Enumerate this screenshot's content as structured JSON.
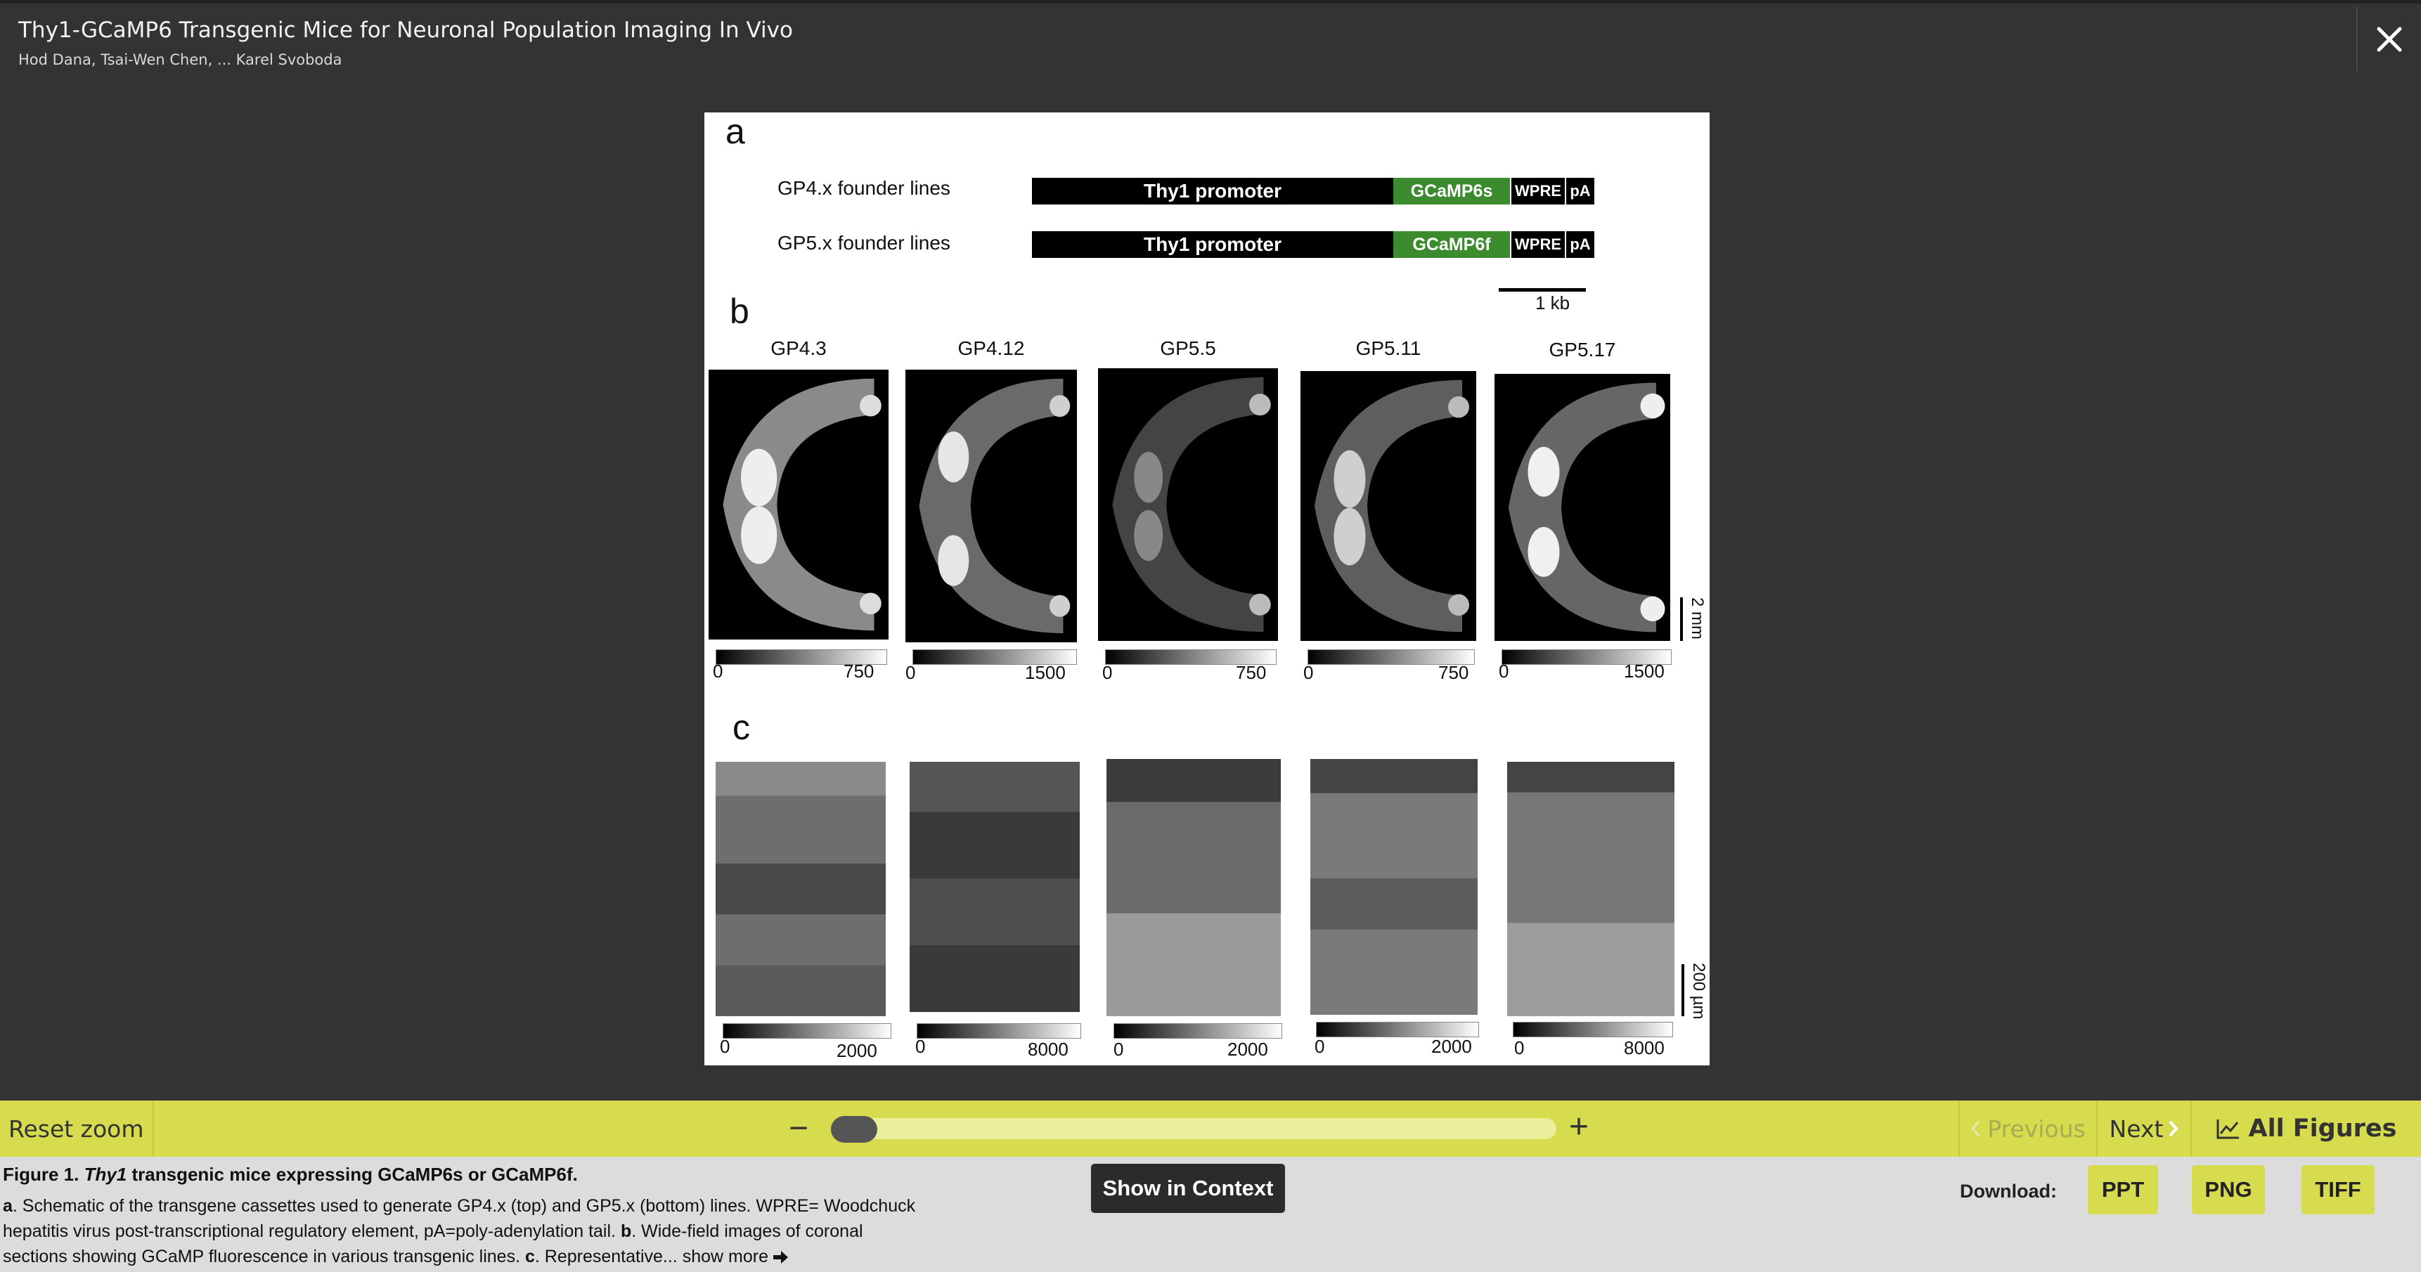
{
  "header": {
    "title": "Thy1-GCaMP6 Transgenic Mice for Neuronal Population Imaging In Vivo",
    "authors": "Hod Dana,  Tsai-Wen Chen,  ... Karel Svoboda",
    "close_icon": "close-icon"
  },
  "figure": {
    "panel_a": "a",
    "panel_b": "b",
    "panel_c": "c",
    "lines": [
      {
        "label": "GP4.x founder lines",
        "promoter": "Thy1 promoter",
        "indicator": "GCaMP6s",
        "wpre": "WPRE",
        "pa": "pA"
      },
      {
        "label": "GP5.x founder lines",
        "promoter": "Thy1 promoter",
        "indicator": "GCaMP6f",
        "wpre": "WPRE",
        "pa": "pA"
      }
    ],
    "kb_scale": "1 kb",
    "columns": [
      {
        "name": "GP4.3",
        "b_min": "0",
        "b_max": "750",
        "c_min": "0",
        "c_max": "2000"
      },
      {
        "name": "GP4.12",
        "b_min": "0",
        "b_max": "1500",
        "c_min": "0",
        "c_max": "8000"
      },
      {
        "name": "GP5.5",
        "b_min": "0",
        "b_max": "750",
        "c_min": "0",
        "c_max": "2000"
      },
      {
        "name": "GP5.11",
        "b_min": "0",
        "b_max": "750",
        "c_min": "0",
        "c_max": "2000"
      },
      {
        "name": "GP5.17",
        "b_min": "0",
        "b_max": "1500",
        "c_min": "0",
        "c_max": "8000"
      }
    ],
    "scale_b": "2 mm",
    "scale_c": "200 µm",
    "colors": {
      "indicator_green": "#3c8c2f"
    }
  },
  "zoom_bar": {
    "reset_label": "Reset zoom",
    "minus": "−",
    "plus": "+",
    "zoom_level": 0.0,
    "previous_label": "Previous",
    "next_label": "Next",
    "all_figures_label": "All Figures",
    "previous_icon": "chevron-left-icon",
    "next_icon": "chevron-right-icon",
    "all_figures_icon": "chart-line-icon",
    "accent": "#d6dc4e"
  },
  "caption": {
    "figure_no": "Figure 1.",
    "title_italic": "Thy1",
    "title_rest": " transgenic mice expressing GCaMP6s or GCaMP6f.",
    "a_letter": "a",
    "a_text": ". Schematic of the transgene cassettes used to generate GP4.x (top) and GP5.x (bottom) lines. WPRE= Woodchuck hepatitis virus post-transcriptional regulatory element, pA=poly-adenylation tail. ",
    "b_letter": "b",
    "b_text": ". Wide-field images of coronal sections showing GCaMP fluorescence in various transgenic lines. ",
    "c_letter": "c",
    "c_text": ". Representative...",
    "show_more": "show more",
    "context_button": "Show in Context",
    "download_label": "Download:",
    "downloads": [
      "PPT",
      "PNG",
      "TIFF"
    ]
  }
}
